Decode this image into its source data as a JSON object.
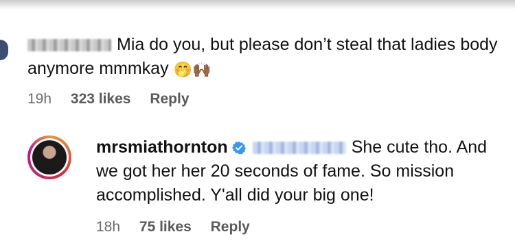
{
  "comment1": {
    "text": "Mia do you, but please don’t steal that ladies body anymore mmmkay",
    "emojis": [
      "🤭",
      "🙌🏾"
    ],
    "time": "19h",
    "likes": "323 likes",
    "reply_label": "Reply"
  },
  "comment2": {
    "username": "mrsmiathornton",
    "text": "She cute tho. And we got her her 20 seconds of fame. So mission accomplished. Y'all did your big one!",
    "time": "18h",
    "likes": "75 likes",
    "reply_label": "Reply"
  },
  "colors": {
    "verified": "#3897f0",
    "meta_text": "#6a6a6a"
  },
  "icons": {
    "verified": "verified-badge-icon"
  }
}
